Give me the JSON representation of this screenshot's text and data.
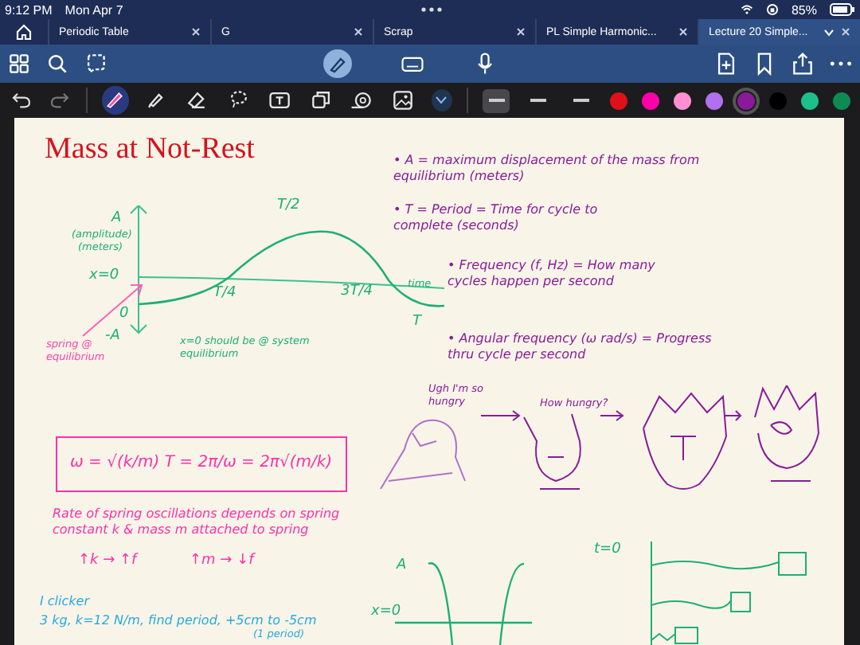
{
  "status_bar": {
    "time": "9:12 PM",
    "date": "Mon Apr 7",
    "battery": "85%"
  },
  "tabs": [
    {
      "label": "Periodic Table",
      "selected": false
    },
    {
      "label": "G",
      "selected": false
    },
    {
      "label": "Scrap",
      "selected": false
    },
    {
      "label": "PL Simple Harmonic...",
      "selected": false
    },
    {
      "label": "Lecture 20 Simple...",
      "selected": true
    }
  ],
  "tools": [
    {
      "kind": "pen",
      "selected": true
    },
    {
      "kind": "highlighter",
      "selected": false
    },
    {
      "kind": "eraser",
      "selected": false
    },
    {
      "kind": "lasso",
      "selected": false
    },
    {
      "kind": "textbox",
      "selected": false
    },
    {
      "kind": "shapes",
      "selected": false
    },
    {
      "kind": "tape",
      "selected": false
    },
    {
      "kind": "image",
      "selected": false
    }
  ],
  "stroke_widths": [
    {
      "selected": true
    },
    {
      "selected": false
    },
    {
      "selected": false
    }
  ],
  "pen_colors": [
    {
      "color": "#e0101b",
      "selected": false
    },
    {
      "color": "#ff00a8",
      "selected": false
    },
    {
      "color": "#ff8fd0",
      "selected": false
    },
    {
      "color": "#b46ef0",
      "selected": false
    },
    {
      "color": "#8a1a9a",
      "selected": true
    },
    {
      "color": "#000000",
      "selected": false
    },
    {
      "color": "#1fbf8a",
      "selected": false
    },
    {
      "color": "#0f8a55",
      "selected": false
    }
  ],
  "notes": [
    {
      "kind": "title",
      "text": "Mass at Not-Rest",
      "color": "#d8101c"
    },
    {
      "kind": "small",
      "text": "A",
      "color": "#1fae78"
    },
    {
      "kind": "tiny",
      "text": "(amplitude)",
      "color": "#1fae78"
    },
    {
      "kind": "tiny",
      "text": "(meters)",
      "color": "#1fae78"
    },
    {
      "kind": "small",
      "text": "x=0",
      "color": "#1fae78"
    },
    {
      "kind": "small",
      "text": "0",
      "color": "#1fae78"
    },
    {
      "kind": "small",
      "text": "-A",
      "color": "#1fae78"
    },
    {
      "kind": "small",
      "text": "T/4",
      "color": "#1fae78"
    },
    {
      "kind": "small",
      "text": "T/2",
      "color": "#1fae78"
    },
    {
      "kind": "small",
      "text": "3T/4",
      "color": "#1fae78"
    },
    {
      "kind": "tiny",
      "text": "time",
      "color": "#1fae78"
    },
    {
      "kind": "small",
      "text": "T",
      "color": "#1fae78"
    },
    {
      "kind": "tiny",
      "text": "spring @ equilibrium",
      "color": "#ff3fb0"
    },
    {
      "kind": "tiny",
      "text": "x=0 should be @ system equilibrium",
      "color": "#1fae78"
    },
    {
      "kind": "body",
      "text": "• A = maximum displacement of the mass from equilibrium (meters)",
      "color": "#8a1a9a"
    },
    {
      "kind": "body",
      "text": "• T = Period = Time for cycle to complete (seconds)",
      "color": "#8a1a9a"
    },
    {
      "kind": "body",
      "text": "• Frequency (f, Hz) = How many cycles happen per second",
      "color": "#8a1a9a"
    },
    {
      "kind": "body",
      "text": "• Angular frequency (ω rad/s) = Progress thru cycle per second",
      "color": "#8a1a9a"
    },
    {
      "kind": "formula",
      "text": "ω = √(k/m)     T = 2π/ω = 2π√(m/k)",
      "color": "#ff2fa8"
    },
    {
      "kind": "body",
      "text": "Rate of spring oscillations depends on spring constant k & mass m attached to spring",
      "color": "#ff2fa8"
    },
    {
      "kind": "small",
      "text": "↑k → ↑f",
      "color": "#ff2fa8"
    },
    {
      "kind": "small",
      "text": "↑m → ↓f",
      "color": "#ff2fa8"
    },
    {
      "kind": "body",
      "text": "I clicker",
      "color": "#29a8e0"
    },
    {
      "kind": "body",
      "text": "3 kg, k=12 N/m, find period, +5cm to -5cm",
      "color": "#29a8e0"
    },
    {
      "kind": "tiny",
      "text": "(1 period)",
      "color": "#29a8e0"
    },
    {
      "kind": "tiny",
      "text": "Ugh I'm so hungry",
      "color": "#8a1a9a"
    },
    {
      "kind": "tiny",
      "text": "How hungry?",
      "color": "#8a1a9a"
    },
    {
      "kind": "small",
      "text": "A",
      "color": "#1fae78"
    },
    {
      "kind": "small",
      "text": "x=0",
      "color": "#1fae78"
    },
    {
      "kind": "small",
      "text": "t=0",
      "color": "#1fae78"
    }
  ]
}
